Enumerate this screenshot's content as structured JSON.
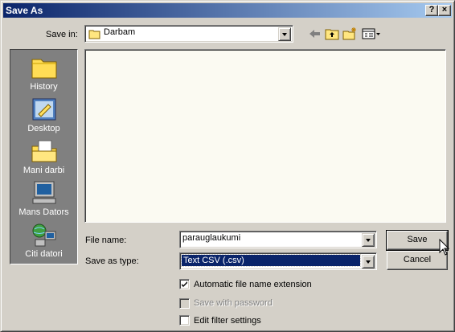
{
  "window": {
    "title": "Save As"
  },
  "titlebar_buttons": {
    "help": "?",
    "close": "×"
  },
  "save_in": {
    "label": "Save in:",
    "value": "Darbam"
  },
  "places": [
    {
      "label": "History"
    },
    {
      "label": "Desktop"
    },
    {
      "label": "Mani darbi"
    },
    {
      "label": "Mans Dators"
    },
    {
      "label": "Citi datori"
    }
  ],
  "file_name": {
    "label": "File name:",
    "value": "parauglaukumi"
  },
  "save_as_type": {
    "label": "Save as type:",
    "value": "Text CSV (.csv)"
  },
  "buttons": {
    "save": "Save",
    "cancel": "Cancel"
  },
  "options": {
    "auto_ext": {
      "label": "Automatic file name extension",
      "checked": true
    },
    "password": {
      "label": "Save with password",
      "checked": false,
      "disabled": true
    },
    "edit_filter": {
      "label": "Edit filter settings",
      "checked": false
    }
  },
  "colors": {
    "title_start": "#0a246a",
    "title_end": "#a6caf0",
    "selection": "#0a246a",
    "face": "#d4d0c8"
  }
}
